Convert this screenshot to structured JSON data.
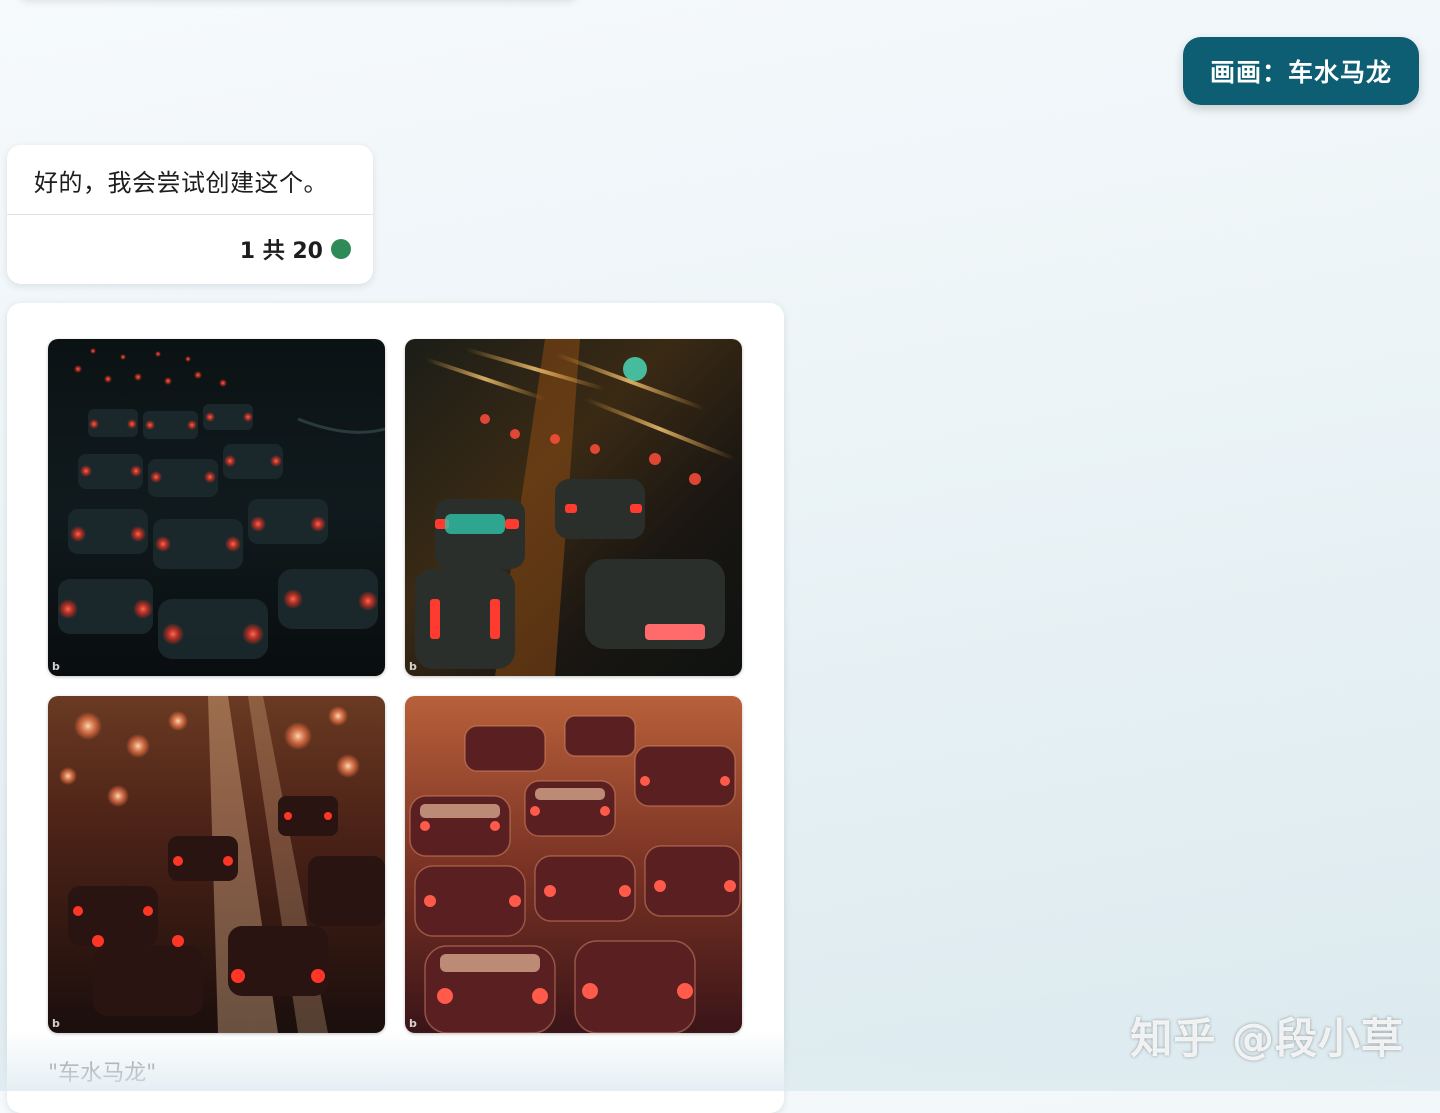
{
  "conversation": {
    "user_message": "画画：车水马龙",
    "bot_reply": "好的，我会尝试创建这个。",
    "turn_counter": "1 共 20",
    "status_color": "#2e8b57"
  },
  "images": {
    "prompt_caption": "\"车水马龙\"",
    "tiles": [
      {
        "name": "generated-image-1",
        "scene": "night-traffic-jam-dark",
        "badge": "b"
      },
      {
        "name": "generated-image-2",
        "scene": "motion-blur-traffic",
        "badge": "b"
      },
      {
        "name": "generated-image-3",
        "scene": "bokeh-traffic-lanes",
        "badge": "b"
      },
      {
        "name": "generated-image-4",
        "scene": "warm-traffic-jam",
        "badge": "b"
      }
    ]
  },
  "watermark": "知乎 @段小草",
  "colors": {
    "user_bubble": "#0d5e73",
    "card_background": "#ffffff",
    "page_background": "#e8f2f6"
  }
}
